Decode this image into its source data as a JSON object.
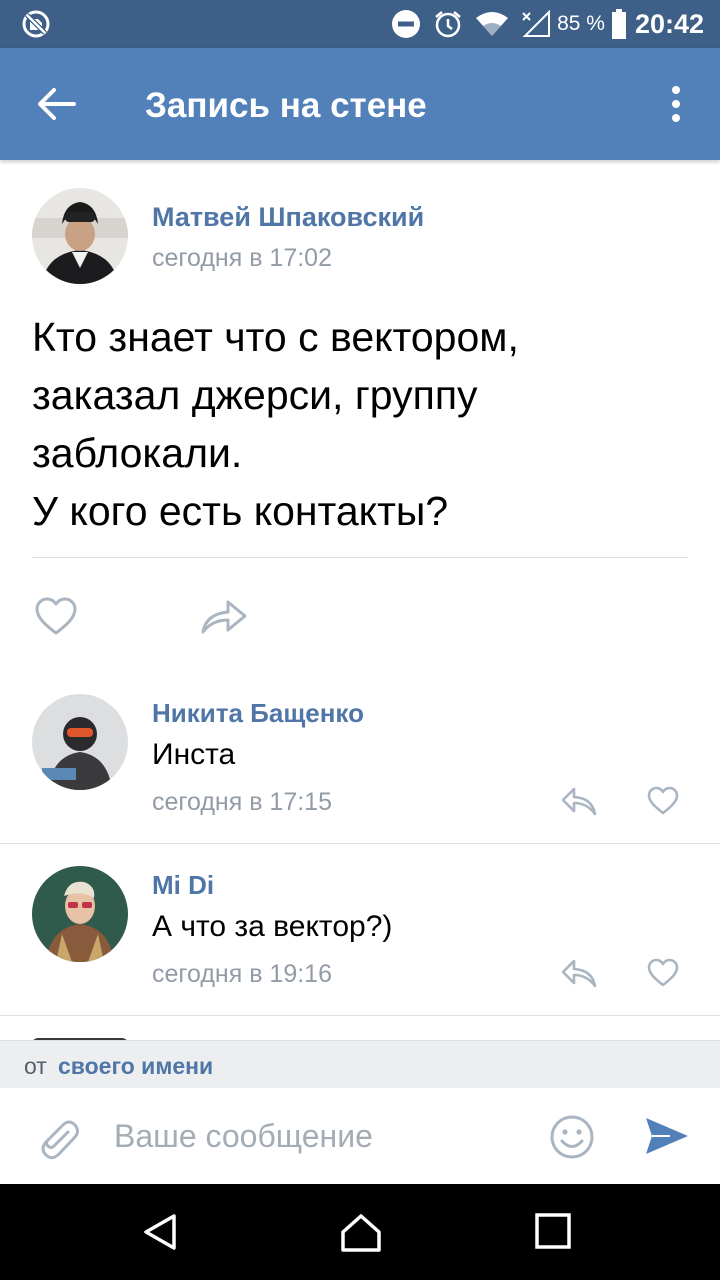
{
  "status_bar": {
    "battery_text": "85 %",
    "time": "20:42",
    "icons": [
      "no-sim-icon",
      "dnd-icon",
      "alarm-icon",
      "wifi-icon",
      "signal-off-icon",
      "battery-icon"
    ]
  },
  "header": {
    "title": "Запись на стене",
    "back_icon": "arrow-left-icon",
    "menu_icon": "more-vertical-icon"
  },
  "post": {
    "author": "Матвей Шпаковский",
    "time": "сегодня в 17:02",
    "text_lines": [
      "Кто знает что с вектором,",
      "заказал джерси, группу",
      "заблокали.",
      "У кого есть контакты?"
    ],
    "actions": [
      "heart-icon",
      "share-icon"
    ]
  },
  "comments": [
    {
      "author": "Никита Бащенко",
      "text": "Инста",
      "time": "сегодня в 17:15"
    },
    {
      "author": "Mi Di",
      "text": "А что за вектор?)",
      "time": "сегодня в 19:16"
    }
  ],
  "composer": {
    "from_prefix": "от",
    "from_link": "своего имени",
    "placeholder": "Ваше сообщение",
    "value": ""
  },
  "colors": {
    "status_bar": "#3d5f88",
    "header": "#5181b8",
    "link": "#4f76a6",
    "muted": "#929ba6",
    "icon": "#aab5c2",
    "send": "#5181b8"
  }
}
